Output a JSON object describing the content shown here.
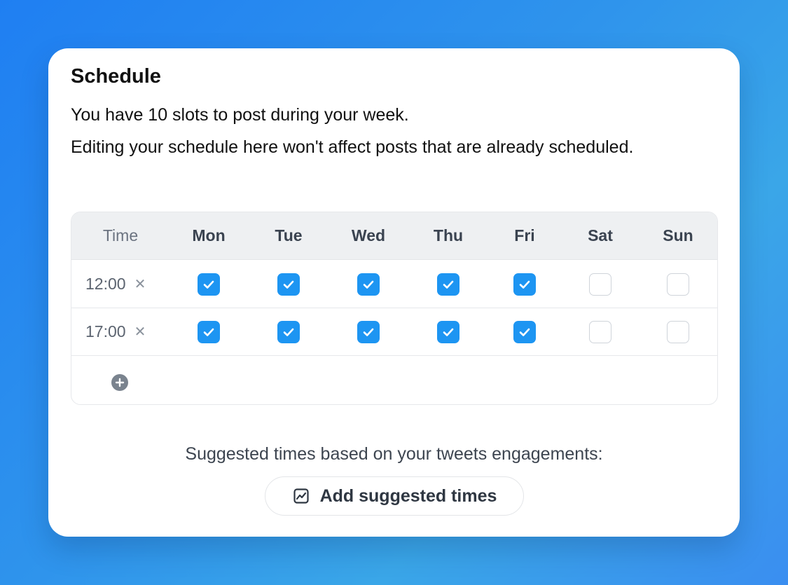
{
  "schedule": {
    "title": "Schedule",
    "slots_text": "You have 10 slots to post during your week.",
    "editing_note": "Editing your schedule here won't affect posts that are already scheduled."
  },
  "table": {
    "time_header": "Time",
    "days": [
      "Mon",
      "Tue",
      "Wed",
      "Thu",
      "Fri",
      "Sat",
      "Sun"
    ],
    "rows": [
      {
        "time": "12:00",
        "checked": [
          true,
          true,
          true,
          true,
          true,
          false,
          false
        ]
      },
      {
        "time": "17:00",
        "checked": [
          true,
          true,
          true,
          true,
          true,
          false,
          false
        ]
      }
    ],
    "remove_icon": "close-icon",
    "add_icon": "plus-circle-icon"
  },
  "suggestions": {
    "text": "Suggested times based on your tweets engagements:",
    "button_label": "Add suggested times",
    "button_icon": "chart-line-icon"
  },
  "colors": {
    "accent": "#1d95f2",
    "background_gradient_start": "#1f7ff2",
    "background_gradient_end": "#3aa6e8"
  }
}
